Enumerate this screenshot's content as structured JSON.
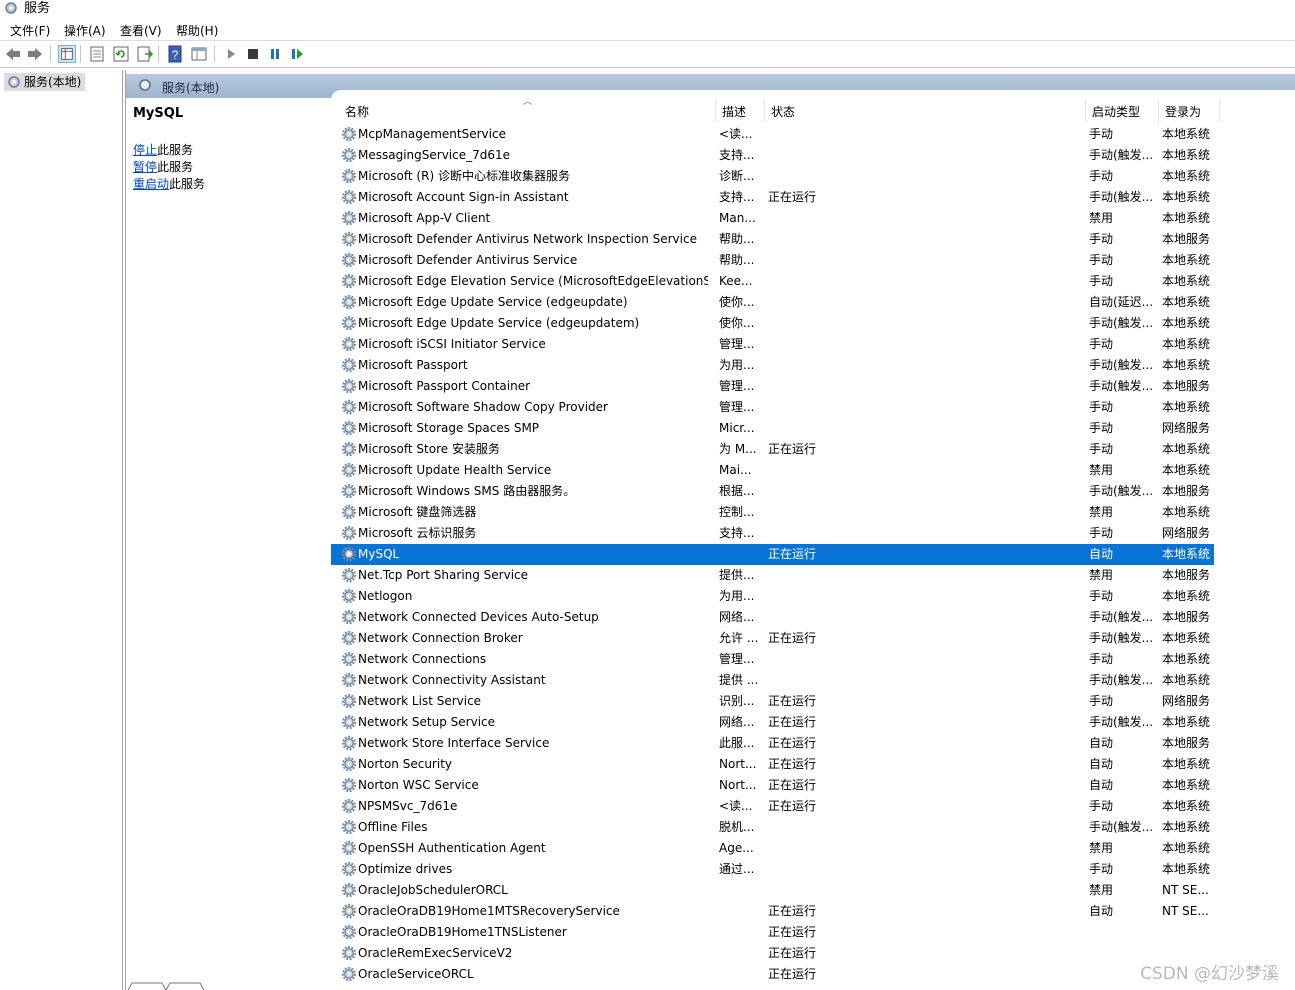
{
  "window": {
    "title": "服务"
  },
  "menu": [
    "文件(F)",
    "操作(A)",
    "查看(V)",
    "帮助(H)"
  ],
  "tree": {
    "root": "服务(本地)"
  },
  "panel": {
    "header": "服务(本地)"
  },
  "detail": {
    "service_name": "MySQL",
    "actions": [
      {
        "link": "停止",
        "rest": "此服务"
      },
      {
        "link": "暂停",
        "rest": "此服务"
      },
      {
        "link": "重启动",
        "rest": "此服务"
      }
    ]
  },
  "columns": {
    "name": "名称",
    "desc": "描述",
    "state": "状态",
    "startup": "启动类型",
    "logon": "登录为"
  },
  "services": [
    {
      "name": "McpManagementService",
      "desc": "<读...",
      "state": "",
      "startup": "手动",
      "logon": "本地系统"
    },
    {
      "name": "MessagingService_7d61e",
      "desc": "支持...",
      "state": "",
      "startup": "手动(触发...",
      "logon": "本地系统"
    },
    {
      "name": "Microsoft (R) 诊断中心标准收集器服务",
      "desc": "诊断...",
      "state": "",
      "startup": "手动",
      "logon": "本地系统"
    },
    {
      "name": "Microsoft Account Sign-in Assistant",
      "desc": "支持...",
      "state": "正在运行",
      "startup": "手动(触发...",
      "logon": "本地系统"
    },
    {
      "name": "Microsoft App-V Client",
      "desc": "Man...",
      "state": "",
      "startup": "禁用",
      "logon": "本地系统"
    },
    {
      "name": "Microsoft Defender Antivirus Network Inspection Service",
      "desc": "帮助...",
      "state": "",
      "startup": "手动",
      "logon": "本地服务"
    },
    {
      "name": "Microsoft Defender Antivirus Service",
      "desc": "帮助...",
      "state": "",
      "startup": "手动",
      "logon": "本地系统"
    },
    {
      "name": "Microsoft Edge Elevation Service (MicrosoftEdgeElevationS...",
      "desc": "Kee...",
      "state": "",
      "startup": "手动",
      "logon": "本地系统"
    },
    {
      "name": "Microsoft Edge Update Service (edgeupdate)",
      "desc": "使你...",
      "state": "",
      "startup": "自动(延迟...",
      "logon": "本地系统"
    },
    {
      "name": "Microsoft Edge Update Service (edgeupdatem)",
      "desc": "使你...",
      "state": "",
      "startup": "手动(触发...",
      "logon": "本地系统"
    },
    {
      "name": "Microsoft iSCSI Initiator Service",
      "desc": "管理...",
      "state": "",
      "startup": "手动",
      "logon": "本地系统"
    },
    {
      "name": "Microsoft Passport",
      "desc": "为用...",
      "state": "",
      "startup": "手动(触发...",
      "logon": "本地系统"
    },
    {
      "name": "Microsoft Passport Container",
      "desc": "管理...",
      "state": "",
      "startup": "手动(触发...",
      "logon": "本地服务"
    },
    {
      "name": "Microsoft Software Shadow Copy Provider",
      "desc": "管理...",
      "state": "",
      "startup": "手动",
      "logon": "本地系统"
    },
    {
      "name": "Microsoft Storage Spaces SMP",
      "desc": "Micr...",
      "state": "",
      "startup": "手动",
      "logon": "网络服务"
    },
    {
      "name": "Microsoft Store 安装服务",
      "desc": "为 M...",
      "state": "正在运行",
      "startup": "手动",
      "logon": "本地系统"
    },
    {
      "name": "Microsoft Update Health Service",
      "desc": "Mai...",
      "state": "",
      "startup": "禁用",
      "logon": "本地系统"
    },
    {
      "name": "Microsoft Windows SMS 路由器服务。",
      "desc": "根据...",
      "state": "",
      "startup": "手动(触发...",
      "logon": "本地服务"
    },
    {
      "name": "Microsoft 键盘筛选器",
      "desc": "控制...",
      "state": "",
      "startup": "禁用",
      "logon": "本地系统"
    },
    {
      "name": "Microsoft 云标识服务",
      "desc": "支持...",
      "state": "",
      "startup": "手动",
      "logon": "网络服务"
    },
    {
      "name": "MySQL",
      "desc": "",
      "state": "正在运行",
      "startup": "自动",
      "logon": "本地系统",
      "selected": true
    },
    {
      "name": "Net.Tcp Port Sharing Service",
      "desc": "提供...",
      "state": "",
      "startup": "禁用",
      "logon": "本地服务"
    },
    {
      "name": "Netlogon",
      "desc": "为用...",
      "state": "",
      "startup": "手动",
      "logon": "本地系统"
    },
    {
      "name": "Network Connected Devices Auto-Setup",
      "desc": "网络...",
      "state": "",
      "startup": "手动(触发...",
      "logon": "本地服务"
    },
    {
      "name": "Network Connection Broker",
      "desc": "允许 ...",
      "state": "正在运行",
      "startup": "手动(触发...",
      "logon": "本地系统"
    },
    {
      "name": "Network Connections",
      "desc": "管理...",
      "state": "",
      "startup": "手动",
      "logon": "本地系统"
    },
    {
      "name": "Network Connectivity Assistant",
      "desc": "提供 ...",
      "state": "",
      "startup": "手动(触发...",
      "logon": "本地系统"
    },
    {
      "name": "Network List Service",
      "desc": "识别...",
      "state": "正在运行",
      "startup": "手动",
      "logon": "网络服务"
    },
    {
      "name": "Network Setup Service",
      "desc": "网络...",
      "state": "正在运行",
      "startup": "手动(触发...",
      "logon": "本地系统"
    },
    {
      "name": "Network Store Interface Service",
      "desc": "此服...",
      "state": "正在运行",
      "startup": "自动",
      "logon": "本地服务"
    },
    {
      "name": "Norton Security",
      "desc": "Nort...",
      "state": "正在运行",
      "startup": "自动",
      "logon": "本地系统"
    },
    {
      "name": "Norton WSC Service",
      "desc": "Nort...",
      "state": "正在运行",
      "startup": "自动",
      "logon": "本地系统"
    },
    {
      "name": "NPSMSvc_7d61e",
      "desc": "<读...",
      "state": "正在运行",
      "startup": "手动",
      "logon": "本地系统"
    },
    {
      "name": "Offline Files",
      "desc": "脱机...",
      "state": "",
      "startup": "手动(触发...",
      "logon": "本地系统"
    },
    {
      "name": "OpenSSH Authentication Agent",
      "desc": "Age...",
      "state": "",
      "startup": "禁用",
      "logon": "本地系统"
    },
    {
      "name": "Optimize drives",
      "desc": "通过...",
      "state": "",
      "startup": "手动",
      "logon": "本地系统"
    },
    {
      "name": "OracleJobSchedulerORCL",
      "desc": "",
      "state": "",
      "startup": "禁用",
      "logon": "NT SE..."
    },
    {
      "name": "OracleOraDB19Home1MTSRecoveryService",
      "desc": "",
      "state": "正在运行",
      "startup": "自动",
      "logon": "NT SE..."
    },
    {
      "name": "OracleOraDB19Home1TNSListener",
      "desc": "",
      "state": "正在运行",
      "startup": "",
      "logon": ""
    },
    {
      "name": "OracleRemExecServiceV2",
      "desc": "",
      "state": "正在运行",
      "startup": "",
      "logon": ""
    },
    {
      "name": "OracleServiceORCL",
      "desc": "",
      "state": "正在运行",
      "startup": "",
      "logon": ""
    }
  ],
  "watermark": "CSDN @幻沙梦溪",
  "colors": {
    "selection": "#0a74d6",
    "link": "#0044cc",
    "header_band": "#a8bdd6"
  },
  "icons": [
    "back-arrow-icon",
    "forward-arrow-icon",
    "console-tree-icon",
    "properties-icon",
    "refresh-icon",
    "export-list-icon",
    "help-icon",
    "view-icon",
    "start-service-icon",
    "stop-service-icon",
    "pause-service-icon",
    "restart-service-icon",
    "gear-icon"
  ]
}
